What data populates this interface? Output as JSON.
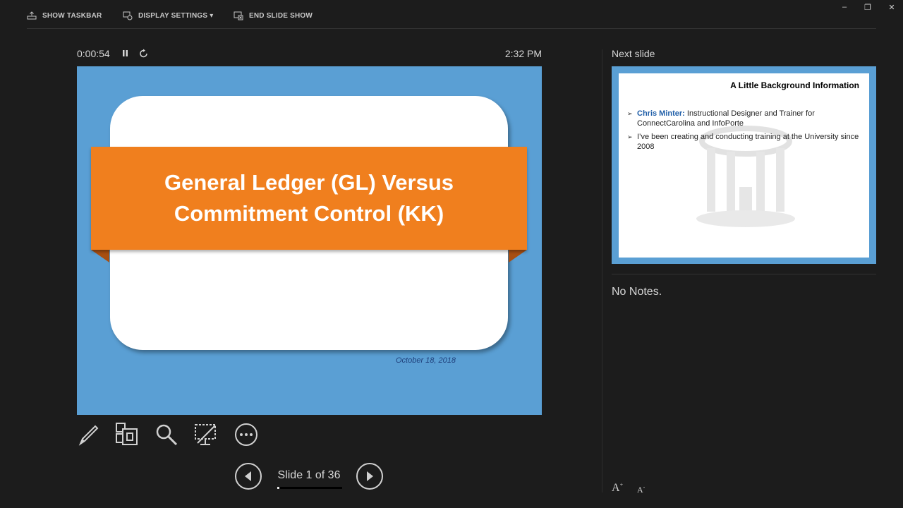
{
  "toolbar": {
    "show_taskbar": "SHOW TASKBAR",
    "display_settings": "DISPLAY SETTINGS ▾",
    "end_slide_show": "END SLIDE SHOW",
    "minimize": "–",
    "restore": "❐",
    "close": "✕"
  },
  "timer": {
    "elapsed": "0:00:54",
    "clock": "2:32 PM"
  },
  "current_slide": {
    "title_line1": "General Ledger (GL) Versus",
    "title_line2": "Commitment Control (KK)",
    "date": "October 18, 2018",
    "background_color": "#5a9fd4",
    "ribbon_color": "#f07f1e"
  },
  "tools": [
    "pen-icon",
    "slides-grid-icon",
    "zoom-icon",
    "black-screen-icon",
    "more-options-icon"
  ],
  "navigation": {
    "slide_counter": "Slide 1 of 36",
    "current": 1,
    "total": 36
  },
  "next_slide": {
    "label": "Next slide",
    "title": "A Little Background Information",
    "bullets": [
      {
        "highlight": "Chris Minter:",
        "text": " Instructional Designer and Trainer for ConnectCarolina and InfoPorte"
      },
      {
        "highlight": "",
        "text": "I’ve been creating and conducting training at the University since 2008"
      }
    ]
  },
  "notes": {
    "text": "No Notes."
  }
}
